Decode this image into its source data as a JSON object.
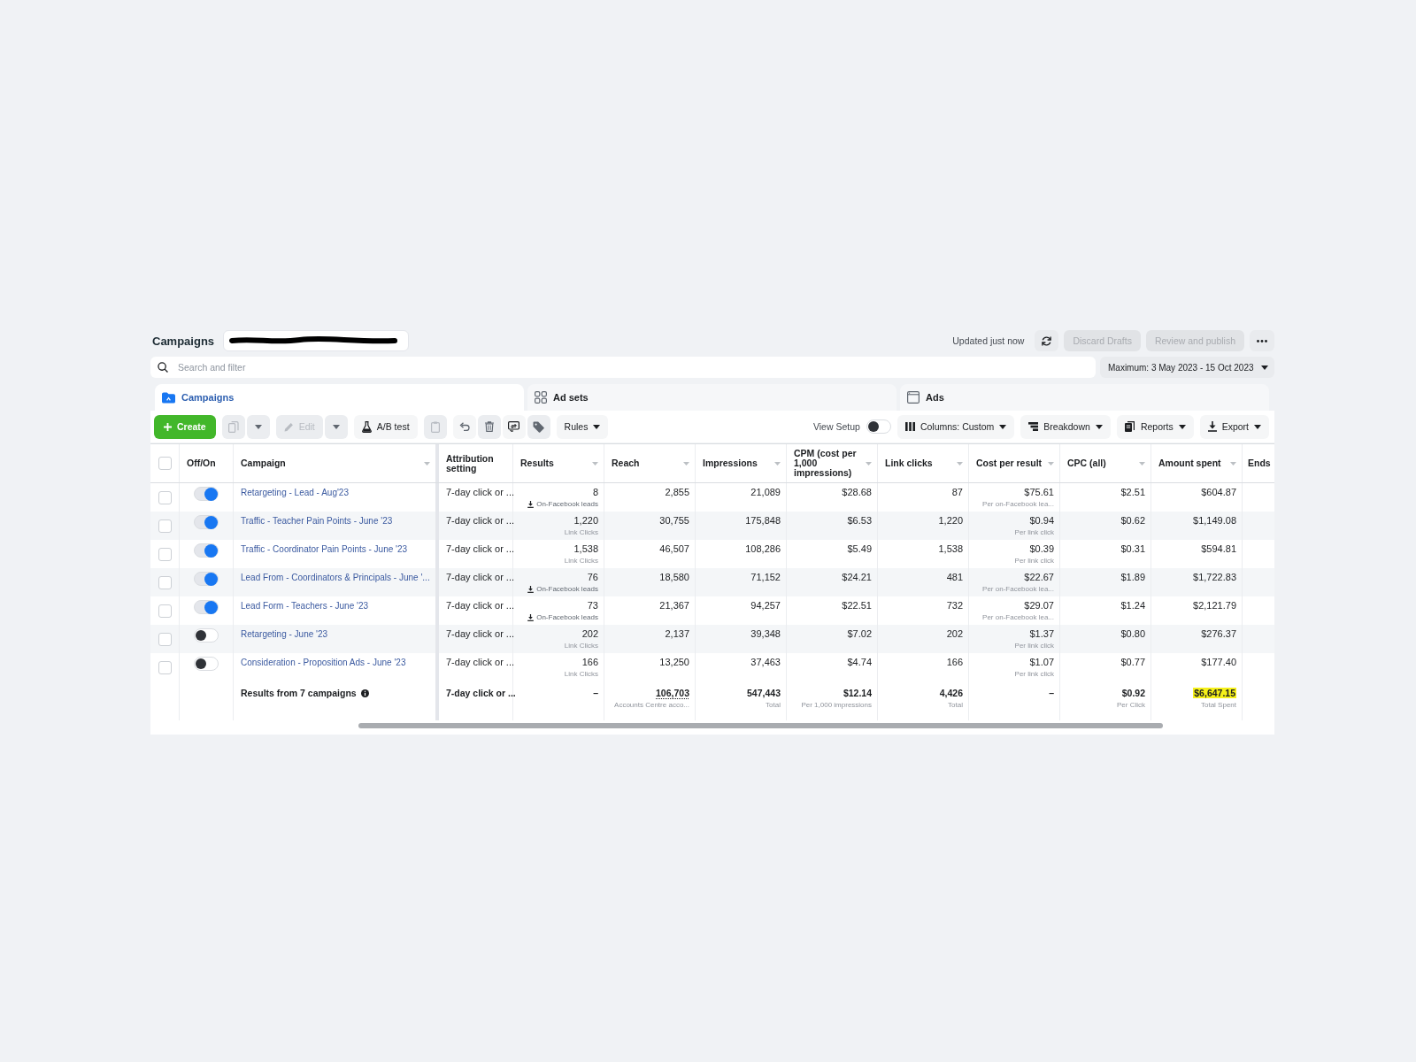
{
  "header": {
    "title": "Campaigns",
    "status": "Updated just now",
    "actions": [
      {
        "label": "Discard Drafts",
        "disabled": true
      },
      {
        "label": "Review and publish",
        "disabled": true
      }
    ]
  },
  "search": {
    "placeholder": "Search and filter"
  },
  "date_range": {
    "label": "Maximum: 3 May 2023 - 15 Oct 2023"
  },
  "tabs": [
    {
      "label": "Campaigns",
      "selected": true
    },
    {
      "label": "Ad sets",
      "selected": false
    },
    {
      "label": "Ads",
      "selected": false
    }
  ],
  "toolbar": {
    "create": {
      "label": "Create"
    },
    "duplicate": {
      "disabled": true
    },
    "edit": {
      "label": "Edit",
      "disabled": true
    },
    "ab_test": {
      "label": "A/B test"
    },
    "rules": {
      "label": "Rules"
    },
    "view_setup": {
      "label": "View Setup",
      "on": false
    },
    "columns": {
      "label": "Columns: Custom"
    },
    "breakdown": {
      "label": "Breakdown"
    },
    "reports": {
      "label": "Reports"
    },
    "export": {
      "label": "Export"
    }
  },
  "table": {
    "select_all": {
      "checked": false
    },
    "columns": [
      {
        "label": "Off/On",
        "sortable": false
      },
      {
        "label": "Campaign",
        "sortable": true
      },
      {
        "label": "Attribution setting",
        "sortable": false
      },
      {
        "label": "Results",
        "sortable": true
      },
      {
        "label": "Reach",
        "sortable": true
      },
      {
        "label": "Impressions",
        "sortable": true
      },
      {
        "label": "CPM (cost per 1,000 impressions)",
        "sortable": true
      },
      {
        "label": "Link clicks",
        "sortable": true
      },
      {
        "label": "Cost per result",
        "sortable": true
      },
      {
        "label": "CPC (all)",
        "sortable": true
      },
      {
        "label": "Amount spent",
        "sortable": true
      },
      {
        "label": "Ends",
        "sortable": false
      }
    ],
    "rows": [
      {
        "selected": false,
        "cells": [
          {
            "kind": "toggle",
            "on": true
          },
          {
            "kind": "link",
            "value": "Retargeting - Lead - Aug'23"
          },
          {
            "kind": "text",
            "value": "7-day click or ..."
          },
          {
            "kind": "number",
            "value": "8",
            "note": {
              "text": "On-Facebook leads",
              "kind": "lead"
            }
          },
          {
            "kind": "number",
            "value": "2,855"
          },
          {
            "kind": "number",
            "value": "21,089"
          },
          {
            "kind": "number",
            "value": "$28.68"
          },
          {
            "kind": "number",
            "value": "87"
          },
          {
            "kind": "number",
            "value": "$75.61",
            "note": {
              "text": "Per on-Facebook lea...",
              "kind": "plain"
            }
          },
          {
            "kind": "number",
            "value": "$2.51"
          },
          {
            "kind": "number",
            "value": "$604.87"
          }
        ]
      },
      {
        "selected": false,
        "cells": [
          {
            "kind": "toggle",
            "on": true
          },
          {
            "kind": "link",
            "value": "Traffic - Teacher Pain Points - June '23"
          },
          {
            "kind": "text",
            "value": "7-day click or ..."
          },
          {
            "kind": "number",
            "value": "1,220",
            "note": {
              "text": "Link Clicks",
              "kind": "plain"
            }
          },
          {
            "kind": "number",
            "value": "30,755"
          },
          {
            "kind": "number",
            "value": "175,848"
          },
          {
            "kind": "number",
            "value": "$6.53"
          },
          {
            "kind": "number",
            "value": "1,220"
          },
          {
            "kind": "number",
            "value": "$0.94",
            "note": {
              "text": "Per link click",
              "kind": "plain"
            }
          },
          {
            "kind": "number",
            "value": "$0.62"
          },
          {
            "kind": "number",
            "value": "$1,149.08"
          }
        ]
      },
      {
        "selected": false,
        "cells": [
          {
            "kind": "toggle",
            "on": true
          },
          {
            "kind": "link",
            "value": "Traffic - Coordinator Pain Points - June '23"
          },
          {
            "kind": "text",
            "value": "7-day click or ..."
          },
          {
            "kind": "number",
            "value": "1,538",
            "note": {
              "text": "Link Clicks",
              "kind": "plain"
            }
          },
          {
            "kind": "number",
            "value": "46,507"
          },
          {
            "kind": "number",
            "value": "108,286"
          },
          {
            "kind": "number",
            "value": "$5.49"
          },
          {
            "kind": "number",
            "value": "1,538"
          },
          {
            "kind": "number",
            "value": "$0.39",
            "note": {
              "text": "Per link click",
              "kind": "plain"
            }
          },
          {
            "kind": "number",
            "value": "$0.31"
          },
          {
            "kind": "number",
            "value": "$594.81"
          }
        ]
      },
      {
        "selected": false,
        "cells": [
          {
            "kind": "toggle",
            "on": true
          },
          {
            "kind": "link",
            "value": "Lead From - Coordinators & Principals - June '..."
          },
          {
            "kind": "text",
            "value": "7-day click or ..."
          },
          {
            "kind": "number",
            "value": "76",
            "note": {
              "text": "On-Facebook leads",
              "kind": "lead"
            }
          },
          {
            "kind": "number",
            "value": "18,580"
          },
          {
            "kind": "number",
            "value": "71,152"
          },
          {
            "kind": "number",
            "value": "$24.21"
          },
          {
            "kind": "number",
            "value": "481"
          },
          {
            "kind": "number",
            "value": "$22.67",
            "note": {
              "text": "Per on-Facebook lea...",
              "kind": "plain"
            }
          },
          {
            "kind": "number",
            "value": "$1.89"
          },
          {
            "kind": "number",
            "value": "$1,722.83"
          }
        ]
      },
      {
        "selected": false,
        "cells": [
          {
            "kind": "toggle",
            "on": true
          },
          {
            "kind": "link",
            "value": "Lead Form - Teachers - June '23"
          },
          {
            "kind": "text",
            "value": "7-day click or ..."
          },
          {
            "kind": "number",
            "value": "73",
            "note": {
              "text": "On-Facebook leads",
              "kind": "lead"
            }
          },
          {
            "kind": "number",
            "value": "21,367"
          },
          {
            "kind": "number",
            "value": "94,257"
          },
          {
            "kind": "number",
            "value": "$22.51"
          },
          {
            "kind": "number",
            "value": "732"
          },
          {
            "kind": "number",
            "value": "$29.07",
            "note": {
              "text": "Per on-Facebook lea...",
              "kind": "plain"
            }
          },
          {
            "kind": "number",
            "value": "$1.24"
          },
          {
            "kind": "number",
            "value": "$2,121.79"
          }
        ]
      },
      {
        "selected": false,
        "cells": [
          {
            "kind": "toggle",
            "on": false
          },
          {
            "kind": "link",
            "value": "Retargeting - June '23"
          },
          {
            "kind": "text",
            "value": "7-day click or ..."
          },
          {
            "kind": "number",
            "value": "202",
            "note": {
              "text": "Link Clicks",
              "kind": "plain"
            }
          },
          {
            "kind": "number",
            "value": "2,137"
          },
          {
            "kind": "number",
            "value": "39,348"
          },
          {
            "kind": "number",
            "value": "$7.02"
          },
          {
            "kind": "number",
            "value": "202"
          },
          {
            "kind": "number",
            "value": "$1.37",
            "note": {
              "text": "Per link click",
              "kind": "plain"
            }
          },
          {
            "kind": "number",
            "value": "$0.80"
          },
          {
            "kind": "number",
            "value": "$276.37"
          }
        ]
      },
      {
        "selected": false,
        "cells": [
          {
            "kind": "toggle",
            "on": false
          },
          {
            "kind": "link",
            "value": "Consideration - Proposition Ads - June '23"
          },
          {
            "kind": "text",
            "value": "7-day click or ..."
          },
          {
            "kind": "number",
            "value": "166",
            "note": {
              "text": "Link Clicks",
              "kind": "plain"
            }
          },
          {
            "kind": "number",
            "value": "13,250"
          },
          {
            "kind": "number",
            "value": "37,463"
          },
          {
            "kind": "number",
            "value": "$4.74"
          },
          {
            "kind": "number",
            "value": "166"
          },
          {
            "kind": "number",
            "value": "$1.07",
            "note": {
              "text": "Per link click",
              "kind": "plain"
            }
          },
          {
            "kind": "number",
            "value": "$0.77"
          },
          {
            "kind": "number",
            "value": "$177.40"
          }
        ]
      }
    ],
    "total": {
      "cells": [
        "",
        {
          "kind": "label",
          "value": "Results from 7 campaigns"
        },
        {
          "kind": "text",
          "value": "7-day click or ...",
          "underlined": false,
          "highlighted": false
        },
        {
          "kind": "number",
          "value": "–",
          "underlined": false,
          "highlighted": false
        },
        {
          "kind": "number",
          "value": "106,703",
          "note": "Accounts Centre acco...",
          "underlined": true,
          "highlighted": false
        },
        {
          "kind": "number",
          "value": "547,443",
          "note": "Total",
          "underlined": false,
          "highlighted": false
        },
        {
          "kind": "number",
          "value": "$12.14",
          "note": "Per 1,000 impressions",
          "underlined": false,
          "highlighted": false
        },
        {
          "kind": "number",
          "value": "4,426",
          "note": "Total",
          "underlined": false,
          "highlighted": false
        },
        {
          "kind": "number",
          "value": "–",
          "underlined": false,
          "highlighted": false
        },
        {
          "kind": "number",
          "value": "$0.92",
          "note": "Per Click",
          "underlined": false,
          "highlighted": false
        },
        {
          "kind": "number",
          "value": "$6,647.15",
          "note": "Total Spent",
          "underlined": false,
          "highlighted": true
        }
      ]
    }
  }
}
